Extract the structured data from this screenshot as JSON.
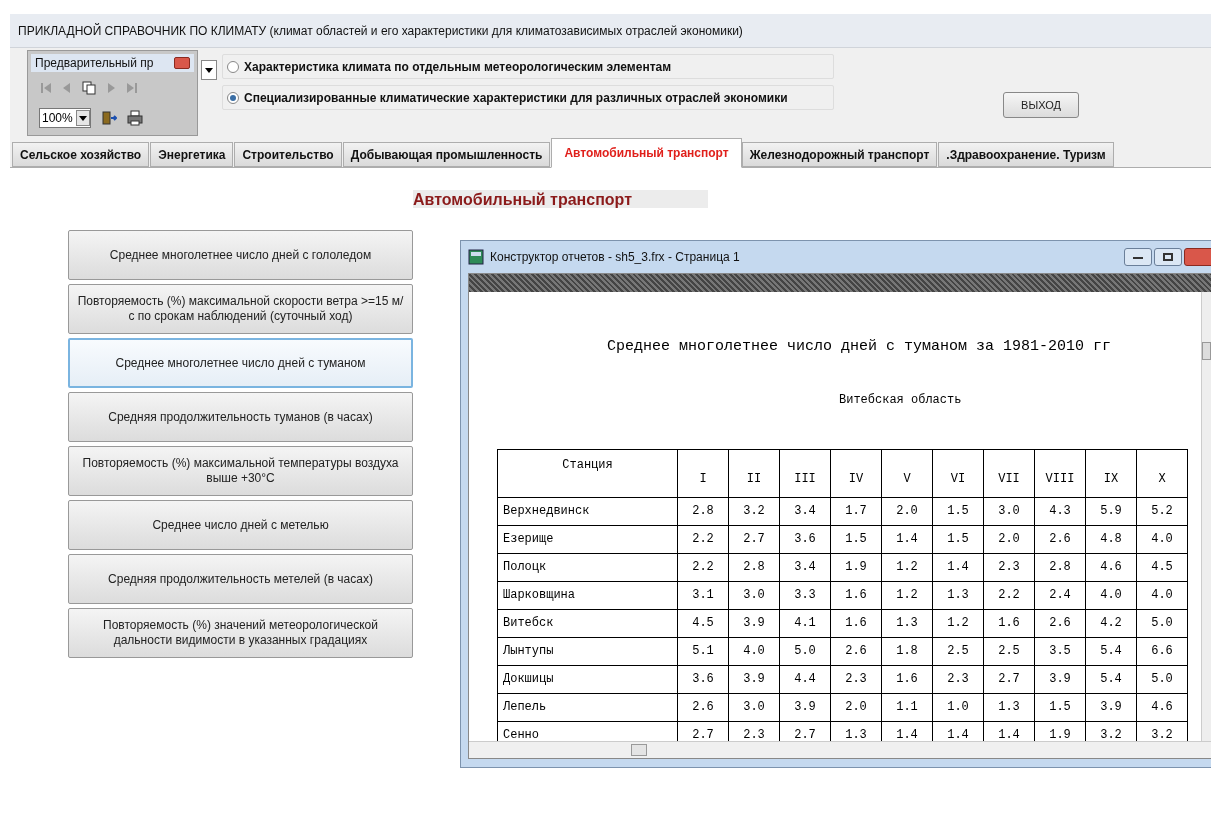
{
  "app": {
    "title": "ПРИКЛАДНОЙ СПРАВОЧНИК ПО КЛИМАТУ (климат  областей и его характеристики для климатозависимых отраслей экономики)"
  },
  "preview_toolbar": {
    "title": "Предварительный пр",
    "zoom": "100%"
  },
  "radio_options": [
    {
      "label": "Характеристика климата по отдельным  метеорологическим элементам",
      "selected": false
    },
    {
      "label": "Специализированные климатические характеристики для различных отраслей экономики",
      "selected": true
    }
  ],
  "exit_button": "ВЫХОД",
  "tabs": [
    {
      "label": "Сельское хозяйство",
      "selected": false
    },
    {
      "label": "Энергетика",
      "selected": false
    },
    {
      "label": "Строительство",
      "selected": false
    },
    {
      "label": "Добывающая промышленность",
      "selected": false
    },
    {
      "label": "Автомобильный транспорт",
      "selected": true
    },
    {
      "label": "Железнодорожный транспорт",
      "selected": false
    },
    {
      "label": ".Здравоохранение. Туризм",
      "selected": false
    }
  ],
  "section_title": "Автомобильный транспорт",
  "report_buttons": [
    {
      "label": "Среднее многолетнее число дней с гололедом",
      "selected": false
    },
    {
      "label": "Повторяемость (%) максимальной скорости ветра >=15 м/с по срокам наблюдений (суточный ход)",
      "selected": false
    },
    {
      "label": "Среднее  многолетнее  число дней с туманом",
      "selected": true
    },
    {
      "label": "Средняя продолжительность туманов (в часах)",
      "selected": false
    },
    {
      "label": "Повторяемость (%) максимальной температуры воздуха выше +30°С",
      "selected": false
    },
    {
      "label": "Среднее число дней с метелью",
      "selected": false
    },
    {
      "label": "Средняя продолжительность метелей (в часах)",
      "selected": false
    },
    {
      "label": "Повторяемость (%) значений метеорологической дальности видимости в указанных градациях",
      "selected": false
    }
  ],
  "report_window": {
    "title": "Конструктор отчетов - sh5_3.frx - Страница 1",
    "report_title": "Среднее многолетнее число дней с туманом за 1981-2010 гг",
    "region": "Витебская область",
    "columns": [
      "Станция",
      "I",
      "II",
      "III",
      "IV",
      "V",
      "VI",
      "VII",
      "VIII",
      "IX",
      "X"
    ],
    "rows": [
      {
        "station": "Верхнедвинск",
        "values": [
          "2.8",
          "3.2",
          "3.4",
          "1.7",
          "2.0",
          "1.5",
          "3.0",
          "4.3",
          "5.9",
          "5.2"
        ]
      },
      {
        "station": "Езерище",
        "values": [
          "2.2",
          "2.7",
          "3.6",
          "1.5",
          "1.4",
          "1.5",
          "2.0",
          "2.6",
          "4.8",
          "4.0"
        ]
      },
      {
        "station": "Полоцк",
        "values": [
          "2.2",
          "2.8",
          "3.4",
          "1.9",
          "1.2",
          "1.4",
          "2.3",
          "2.8",
          "4.6",
          "4.5"
        ]
      },
      {
        "station": "Шарковщина",
        "values": [
          "3.1",
          "3.0",
          "3.3",
          "1.6",
          "1.2",
          "1.3",
          "2.2",
          "2.4",
          "4.0",
          "4.0"
        ]
      },
      {
        "station": "Витебск",
        "values": [
          "4.5",
          "3.9",
          "4.1",
          "1.6",
          "1.3",
          "1.2",
          "1.6",
          "2.6",
          "4.2",
          "5.0"
        ]
      },
      {
        "station": "Лынтупы",
        "values": [
          "5.1",
          "4.0",
          "5.0",
          "2.6",
          "1.8",
          "2.5",
          "2.5",
          "3.5",
          "5.4",
          "6.6"
        ]
      },
      {
        "station": "Докшицы",
        "values": [
          "3.6",
          "3.9",
          "4.4",
          "2.3",
          "1.6",
          "2.3",
          "2.7",
          "3.9",
          "5.4",
          "5.0"
        ]
      },
      {
        "station": "Лепель",
        "values": [
          "2.6",
          "3.0",
          "3.9",
          "2.0",
          "1.1",
          "1.0",
          "1.3",
          "1.5",
          "3.9",
          "4.6"
        ]
      },
      {
        "station": "Сенно",
        "values": [
          "2.7",
          "2.3",
          "2.7",
          "1.3",
          "1.4",
          "1.4",
          "1.4",
          "1.9",
          "3.2",
          "3.2"
        ]
      }
    ]
  }
}
